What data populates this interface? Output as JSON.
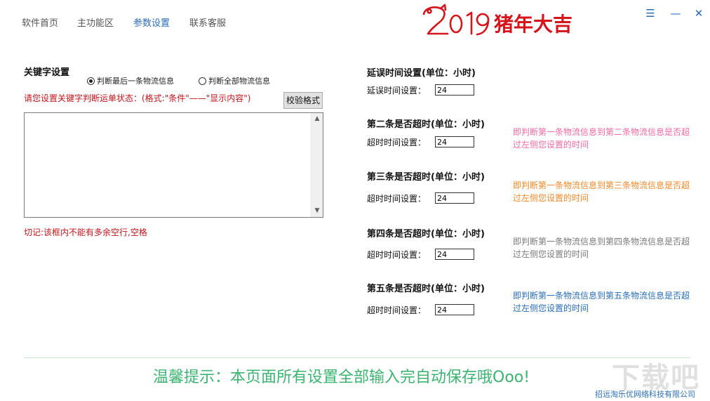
{
  "nav": {
    "items": [
      "软件首页",
      "主功能区",
      "参数设置",
      "联系客服"
    ],
    "active": "参数设置"
  },
  "logo": {
    "year": "2019",
    "text": "猪年大吉"
  },
  "window": {
    "menu_icon": "☰",
    "minimize_icon": "—",
    "close_icon": "✕"
  },
  "keyword": {
    "title": "关键字设置",
    "radio_last": "判断最后一条物流信息",
    "radio_all": "判断全部物流信息",
    "selected": "radio_last",
    "instruction": "请您设置关键字判断运单状态：(格式:\"条件\"——\"显示内容\")",
    "validate_label": "校验格式",
    "textarea_value": "",
    "warning": "切记:该框内不能有多余空行,空格"
  },
  "settings": {
    "delay": {
      "title": "延误时间设置(单位：小时)",
      "label": "延误时间设置：",
      "value": "24"
    },
    "second": {
      "title": "第二条是否超时(单位：小时)",
      "label": "超时时间设置：",
      "value": "24",
      "desc": "即判断第一条物流信息到第二条物流信息是否超过左侧您设置的时间",
      "color": "#f06aa4"
    },
    "third": {
      "title": "第三条是否超时(单位：小时)",
      "label": "超时时间设置：",
      "value": "24",
      "desc": "即判断第一条物流信息到第三条物流信息是否超过左侧您设置的时间",
      "color": "#f0892c"
    },
    "fourth": {
      "title": "第四条是否超时(单位：小时)",
      "label": "超时时间设置：",
      "value": "24",
      "desc": "即判断第一条物流信息到第四条物流信息是否超过左侧您设置的时间",
      "color": "#7a7a7a"
    },
    "fifth": {
      "title": "第五条是否超时(单位：小时)",
      "label": "超时时间设置：",
      "value": "24",
      "desc": "即判断第一条物流信息到第五条物流信息是否超过左侧您设置的时间",
      "color": "#2a6db5"
    }
  },
  "footer": {
    "tip": "温馨提示：本页面所有设置全部输入完自动保存哦Ooo!",
    "company": "招远淘乐优网络科技有限公司",
    "watermark": "下载吧"
  },
  "colors": {
    "accent": "#2a6db5",
    "warning": "#c0141a",
    "tip": "#3cb371",
    "logo": "#d4161c"
  }
}
